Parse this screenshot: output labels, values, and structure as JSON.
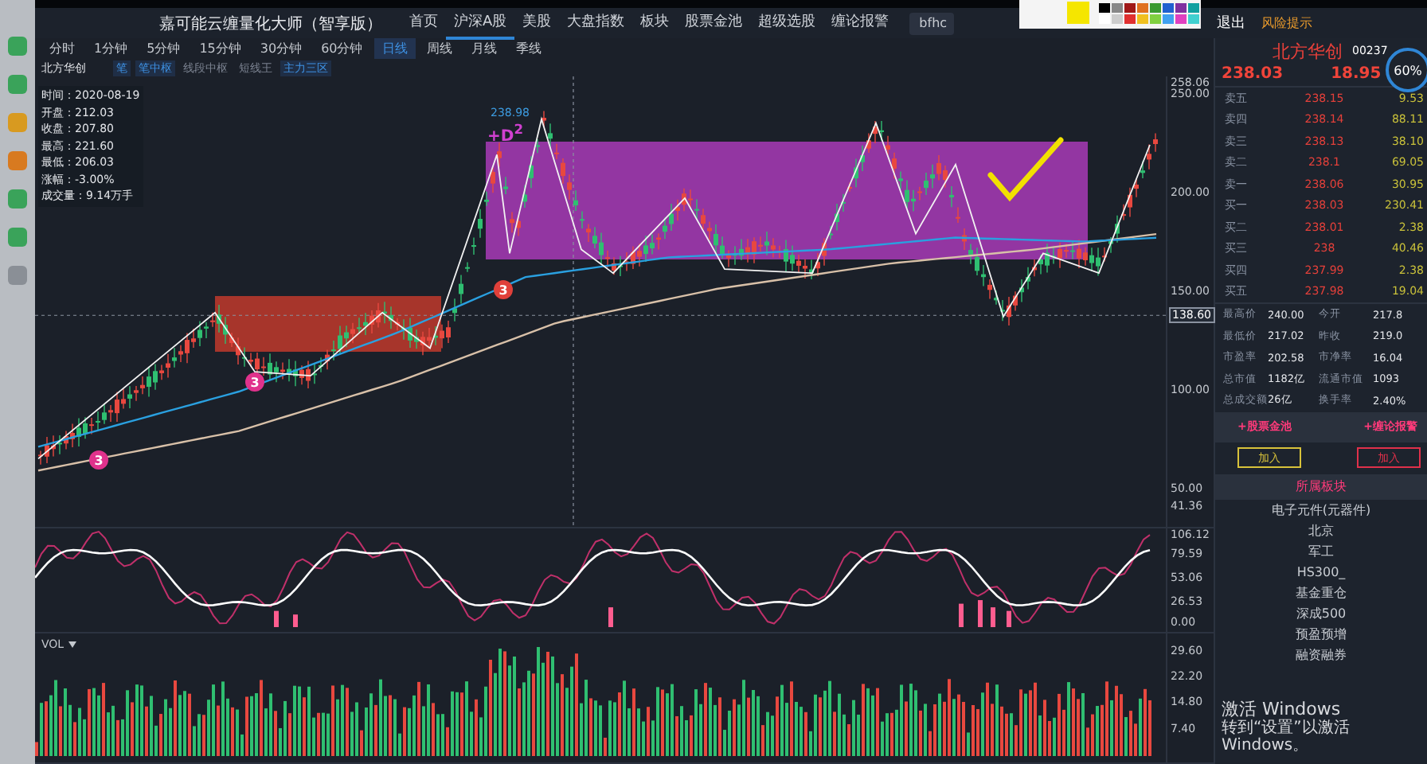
{
  "app": {
    "title": "嘉可能云缠量化大师（智享版）",
    "nav": [
      {
        "label": "首页",
        "selected": false
      },
      {
        "label": "沪深A股",
        "selected": true
      },
      {
        "label": "美股",
        "selected": false
      },
      {
        "label": "大盘指数",
        "selected": false
      },
      {
        "label": "板块",
        "selected": false
      },
      {
        "label": "股票金池",
        "selected": false
      },
      {
        "label": "超级选股",
        "selected": false
      },
      {
        "label": "缠论报警",
        "selected": false
      }
    ],
    "search": {
      "value": "bfhc"
    },
    "logout": "退出",
    "risk": "风险提示"
  },
  "periods": [
    {
      "label": "分时",
      "selected": false
    },
    {
      "label": "1分钟",
      "selected": false
    },
    {
      "label": "5分钟",
      "selected": false
    },
    {
      "label": "15分钟",
      "selected": false
    },
    {
      "label": "30分钟",
      "selected": false
    },
    {
      "label": "60分钟",
      "selected": false
    },
    {
      "label": "日线",
      "selected": true
    },
    {
      "label": "周线",
      "selected": false
    },
    {
      "label": "月线",
      "selected": false
    },
    {
      "label": "季线",
      "selected": false
    }
  ],
  "stock_name": "北方华创",
  "indicators": [
    {
      "label": "笔",
      "selected": true
    },
    {
      "label": "笔中枢",
      "selected": true
    },
    {
      "label": "线段中枢",
      "selected": false
    },
    {
      "label": "短线王",
      "selected": false
    },
    {
      "label": "主力三区",
      "selected": true
    }
  ],
  "info_box": [
    "时间：2020-08-19",
    "开盘：212.03",
    "收盘：207.80",
    "最高：221.60",
    "最低：206.03",
    "涨幅：-3.00%",
    "成交量：9.14万手"
  ],
  "chart": {
    "price_labels": [
      "258.06",
      "250.00",
      "200.00",
      "150.00",
      "100.00",
      "50.00",
      "41.36"
    ],
    "current_tag": "138.60",
    "high_tag": "238.98",
    "signal_label": "+D$^{2}$",
    "markers": [
      "3",
      "3",
      "3"
    ],
    "osc_labels": [
      "106.12",
      "79.59",
      "53.06",
      "26.53",
      "0.00"
    ],
    "vol_title": "VOL",
    "vol_labels": [
      "29.60",
      "22.20",
      "14.80",
      "7.40"
    ]
  },
  "quote": {
    "name": "北方华创",
    "code": "00237",
    "price": "238.03",
    "change": "18.95",
    "gauge": "60%"
  },
  "order_book": [
    {
      "label": "卖五",
      "price": "238.15",
      "volume": "9.53"
    },
    {
      "label": "卖四",
      "price": "238.14",
      "volume": "88.11"
    },
    {
      "label": "卖三",
      "price": "238.13",
      "volume": "38.10"
    },
    {
      "label": "卖二",
      "price": "238.1",
      "volume": "69.05"
    },
    {
      "label": "卖一",
      "price": "238.06",
      "volume": "30.95"
    },
    {
      "label": "买一",
      "price": "238.03",
      "volume": "230.41"
    },
    {
      "label": "买二",
      "price": "238.01",
      "volume": "2.38"
    },
    {
      "label": "买三",
      "price": "238",
      "volume": "40.46"
    },
    {
      "label": "买四",
      "price": "237.99",
      "volume": "2.38"
    },
    {
      "label": "买五",
      "price": "237.98",
      "volume": "19.04"
    }
  ],
  "stats": [
    {
      "label": "最高价",
      "value": "240.00",
      "label2": "今开",
      "value2": "217.8"
    },
    {
      "label": "最低价",
      "value": "217.02",
      "label2": "昨收",
      "value2": "219.0"
    },
    {
      "label": "市盈率",
      "value": "202.58",
      "label2": "市净率",
      "value2": "16.04"
    },
    {
      "label": "总市值",
      "value": "1182亿",
      "label2": "流通市值",
      "value2": "1093"
    },
    {
      "label": "总成交额",
      "value": "26亿",
      "label2": "换手率",
      "value2": "2.40%"
    }
  ],
  "actions": [
    "+股票金池",
    "+缠论报警"
  ],
  "add_buttons": [
    {
      "label": "加入",
      "color": "#d8c23a"
    },
    {
      "label": "加入",
      "color": "#e0304a"
    }
  ],
  "sector_title": "所属板块",
  "sectors": [
    "电子元件(元器件)",
    "北京",
    "军工",
    "HS300_",
    "基金重仓",
    "深成500",
    "预盈预增",
    "融资融券"
  ],
  "os_notice": {
    "title": "激活 Windows",
    "text": "转到“设置”以激活 Windows。"
  }
}
